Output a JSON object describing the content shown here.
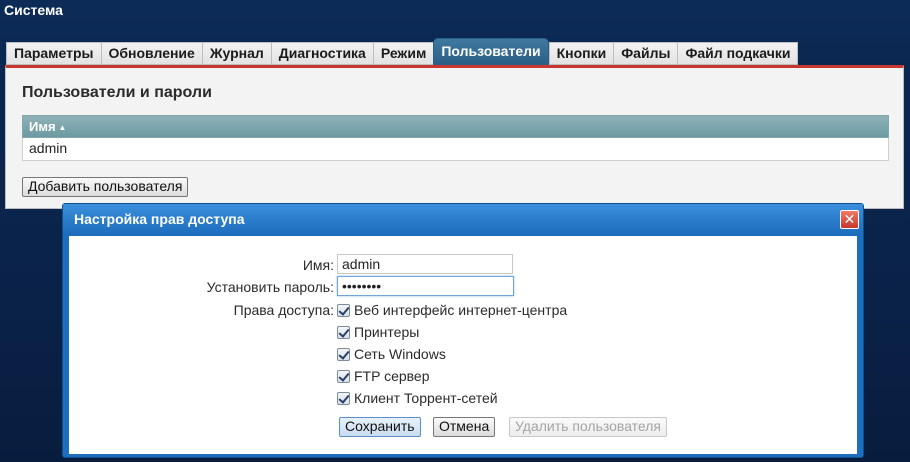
{
  "page": {
    "title": "Система"
  },
  "tabs": [
    {
      "label": "Параметры"
    },
    {
      "label": "Обновление"
    },
    {
      "label": "Журнал"
    },
    {
      "label": "Диагностика"
    },
    {
      "label": "Режим"
    },
    {
      "label": "Пользователи",
      "active": true
    },
    {
      "label": "Кнопки"
    },
    {
      "label": "Файлы"
    },
    {
      "label": "Файл подкачки"
    }
  ],
  "users_section": {
    "title": "Пользователи и пароли",
    "table": {
      "header": "Имя",
      "sort_indicator": "▲",
      "rows": [
        {
          "name": "admin"
        }
      ]
    },
    "add_button": "Добавить пользователя"
  },
  "dialog": {
    "title": "Настройка прав доступа",
    "close_glyph": "✕",
    "name_label": "Имя:",
    "name_value": "admin",
    "password_label": "Установить пароль:",
    "password_mask": "••••••••",
    "rights_label": "Права доступа:",
    "permissions": [
      {
        "label": "Веб интерфейс интернет-центра",
        "checked": true
      },
      {
        "label": "Принтеры",
        "checked": true
      },
      {
        "label": "Сеть Windows",
        "checked": true
      },
      {
        "label": "FTP сервер",
        "checked": true
      },
      {
        "label": "Клиент Торрент-сетей",
        "checked": true
      }
    ],
    "buttons": {
      "save": "Сохранить",
      "cancel": "Отмена",
      "delete": "Удалить пользователя"
    }
  },
  "colors": {
    "accent_red": "#c7372f",
    "tab_active": "#2a5f86",
    "dialog_blue": "#1c6fbf",
    "table_header": "#6c9aa2"
  }
}
